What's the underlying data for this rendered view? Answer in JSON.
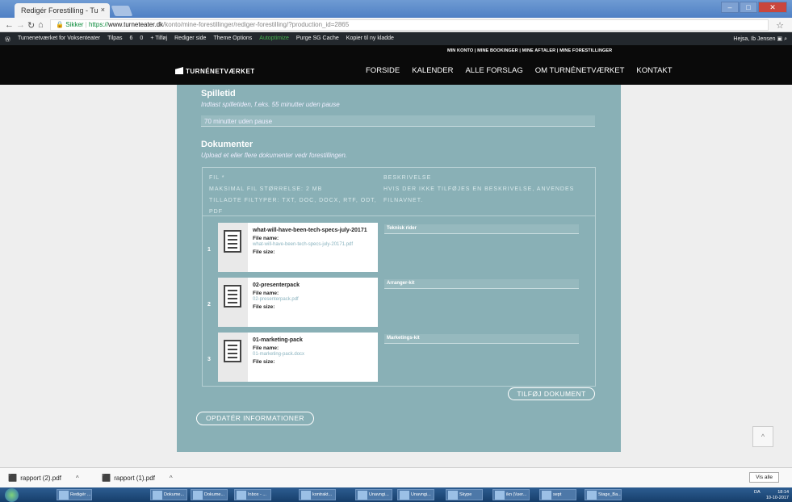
{
  "browser": {
    "tab_title": "Redigér Forestilling - Tu",
    "tab_close": "×",
    "url_secure": "Sikker",
    "url_scheme": "https://",
    "url_host": "www.turneteater.dk",
    "url_path": "/konto/mine-forestillinger/rediger-forestilling/?production_id=2865"
  },
  "wp_admin_bar": {
    "items": [
      "Turnenetværket for Voksenteater",
      "Tilpas",
      "6",
      "0",
      "+ Tilføj",
      "Rediger side",
      "Theme Options",
      "Autoptimize",
      "Purge SG Cache",
      "Kopier til ny kladde"
    ],
    "greeting": "Hejsa, Ib Jensen"
  },
  "site_header": {
    "user_menu": "MIN KONTO  |  MINE BOOKINGER  |  MINE AFTALER  |  MINE FORESTILLINGER",
    "logo": "TURNÉNETVÆRKET",
    "nav": [
      "FORSIDE",
      "KALENDER",
      "ALLE FORSLAG",
      "OM TURNÉNETVÆRKET",
      "KONTAKT"
    ]
  },
  "form": {
    "spilletid": {
      "title": "Spilletid",
      "desc": "Indtast spilletiden, f.eks. 55 minutter uden pause",
      "value": "70 minutter uden pause"
    },
    "dokumenter": {
      "title": "Dokumenter",
      "desc": "Upload et eller flere dokumenter vedr forestillingen.",
      "col_file": "FIL *\nMAKSIMAL FIL STØRRELSE: 2 MB\nTILLADTE FILTYPER: TXT, DOC, DOCX, RTF, ODT, PDF",
      "col_desc": "BESKRIVELSE\nHVIS DER IKKE TILFØJES EN BESKRIVELSE, ANVENDES FILNAVNET.",
      "rows": [
        {
          "num": "1",
          "title": "what-will-have-been-tech-specs-july-20171",
          "file_name_label": "File name:",
          "file_name": "what-will-have-been-tech-specs-july-20171.pdf",
          "file_size_label": "File size:",
          "description": "Teknisk rider"
        },
        {
          "num": "2",
          "title": "02-presenterpack",
          "file_name_label": "File name:",
          "file_name": "02-presenterpack.pdf",
          "file_size_label": "File size:",
          "description": "Arranger-kit"
        },
        {
          "num": "3",
          "title": "01-marketing-pack",
          "file_name_label": "File name:",
          "file_name": "01-marketing-pack.docx",
          "file_size_label": "File size:",
          "description": "Marketings-kit"
        }
      ],
      "add_button": "TILFØJ DOKUMENT"
    },
    "update_button": "OPDATÉR INFORMATIONER"
  },
  "scroll_top": "^",
  "downloads": {
    "items": [
      "rapport (2).pdf",
      "rapport (1).pdf"
    ],
    "show_all": "Vis alle"
  },
  "taskbar": {
    "items": [
      "Redigér ...",
      "Dokume...",
      "Dokume...",
      "Inbox - ...",
      "kontrakt...",
      "Unavngi...",
      "Unavngi...",
      "Skype",
      "ikn (\\\\ser...",
      "sept",
      "Stage_Ba..."
    ],
    "lang": "DA",
    "time": "18:14",
    "date": "10-10-2017"
  }
}
